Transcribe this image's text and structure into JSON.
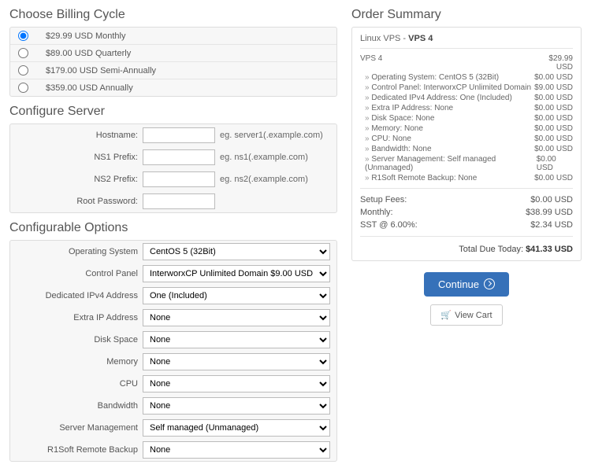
{
  "sections": {
    "billing_title": "Choose Billing Cycle",
    "configure_title": "Configure Server",
    "options_title": "Configurable Options",
    "summary_title": "Order Summary"
  },
  "billing": [
    {
      "label": "$29.99 USD Monthly",
      "selected": true
    },
    {
      "label": "$89.00 USD Quarterly",
      "selected": false
    },
    {
      "label": "$179.00 USD Semi-Annually",
      "selected": false
    },
    {
      "label": "$359.00 USD Annually",
      "selected": false
    }
  ],
  "config": {
    "hostname": {
      "label": "Hostname:",
      "value": "",
      "hint": "eg. server1(.example.com)"
    },
    "ns1": {
      "label": "NS1 Prefix:",
      "value": "",
      "hint": "eg. ns1(.example.com)"
    },
    "ns2": {
      "label": "NS2 Prefix:",
      "value": "",
      "hint": "eg. ns2(.example.com)"
    },
    "root": {
      "label": "Root Password:",
      "value": ""
    }
  },
  "options": [
    {
      "label": "Operating System",
      "value": "CentOS 5 (32Bit)"
    },
    {
      "label": "Control Panel",
      "value": "InterworxCP Unlimited Domain $9.00 USD"
    },
    {
      "label": "Dedicated IPv4 Address",
      "value": "One (Included)"
    },
    {
      "label": "Extra IP Address",
      "value": "None"
    },
    {
      "label": "Disk Space",
      "value": "None"
    },
    {
      "label": "Memory",
      "value": "None"
    },
    {
      "label": "CPU",
      "value": "None"
    },
    {
      "label": "Bandwidth",
      "value": "None"
    },
    {
      "label": "Server Management",
      "value": "Self managed (Unmanaged)"
    },
    {
      "label": "R1Soft Remote Backup",
      "value": "None"
    }
  ],
  "summary": {
    "product_prefix": "Linux VPS - ",
    "product": "VPS 4",
    "base": {
      "name": "VPS 4",
      "price": "$29.99 USD"
    },
    "items": [
      {
        "name": "Operating System: CentOS 5 (32Bit)",
        "price": "$0.00 USD"
      },
      {
        "name": "Control Panel: InterworxCP Unlimited Domain",
        "price": "$9.00 USD"
      },
      {
        "name": "Dedicated IPv4 Address: One (Included)",
        "price": "$0.00 USD"
      },
      {
        "name": "Extra IP Address: None",
        "price": "$0.00 USD"
      },
      {
        "name": "Disk Space: None",
        "price": "$0.00 USD"
      },
      {
        "name": "Memory: None",
        "price": "$0.00 USD"
      },
      {
        "name": "CPU: None",
        "price": "$0.00 USD"
      },
      {
        "name": "Bandwidth: None",
        "price": "$0.00 USD"
      },
      {
        "name": "Server Management: Self managed (Unmanaged)",
        "price": "$0.00 USD"
      },
      {
        "name": "R1Soft Remote Backup: None",
        "price": "$0.00 USD"
      }
    ],
    "totals": [
      {
        "label": "Setup Fees:",
        "value": "$0.00 USD"
      },
      {
        "label": "Monthly:",
        "value": "$38.99 USD"
      },
      {
        "label": "SST @ 6.00%:",
        "value": "$2.34 USD"
      }
    ],
    "due_label": "Total Due Today: ",
    "due_value": "$41.33 USD"
  },
  "buttons": {
    "continue": "Continue",
    "view_cart": "View Cart",
    "cart_icon": "🛒"
  }
}
